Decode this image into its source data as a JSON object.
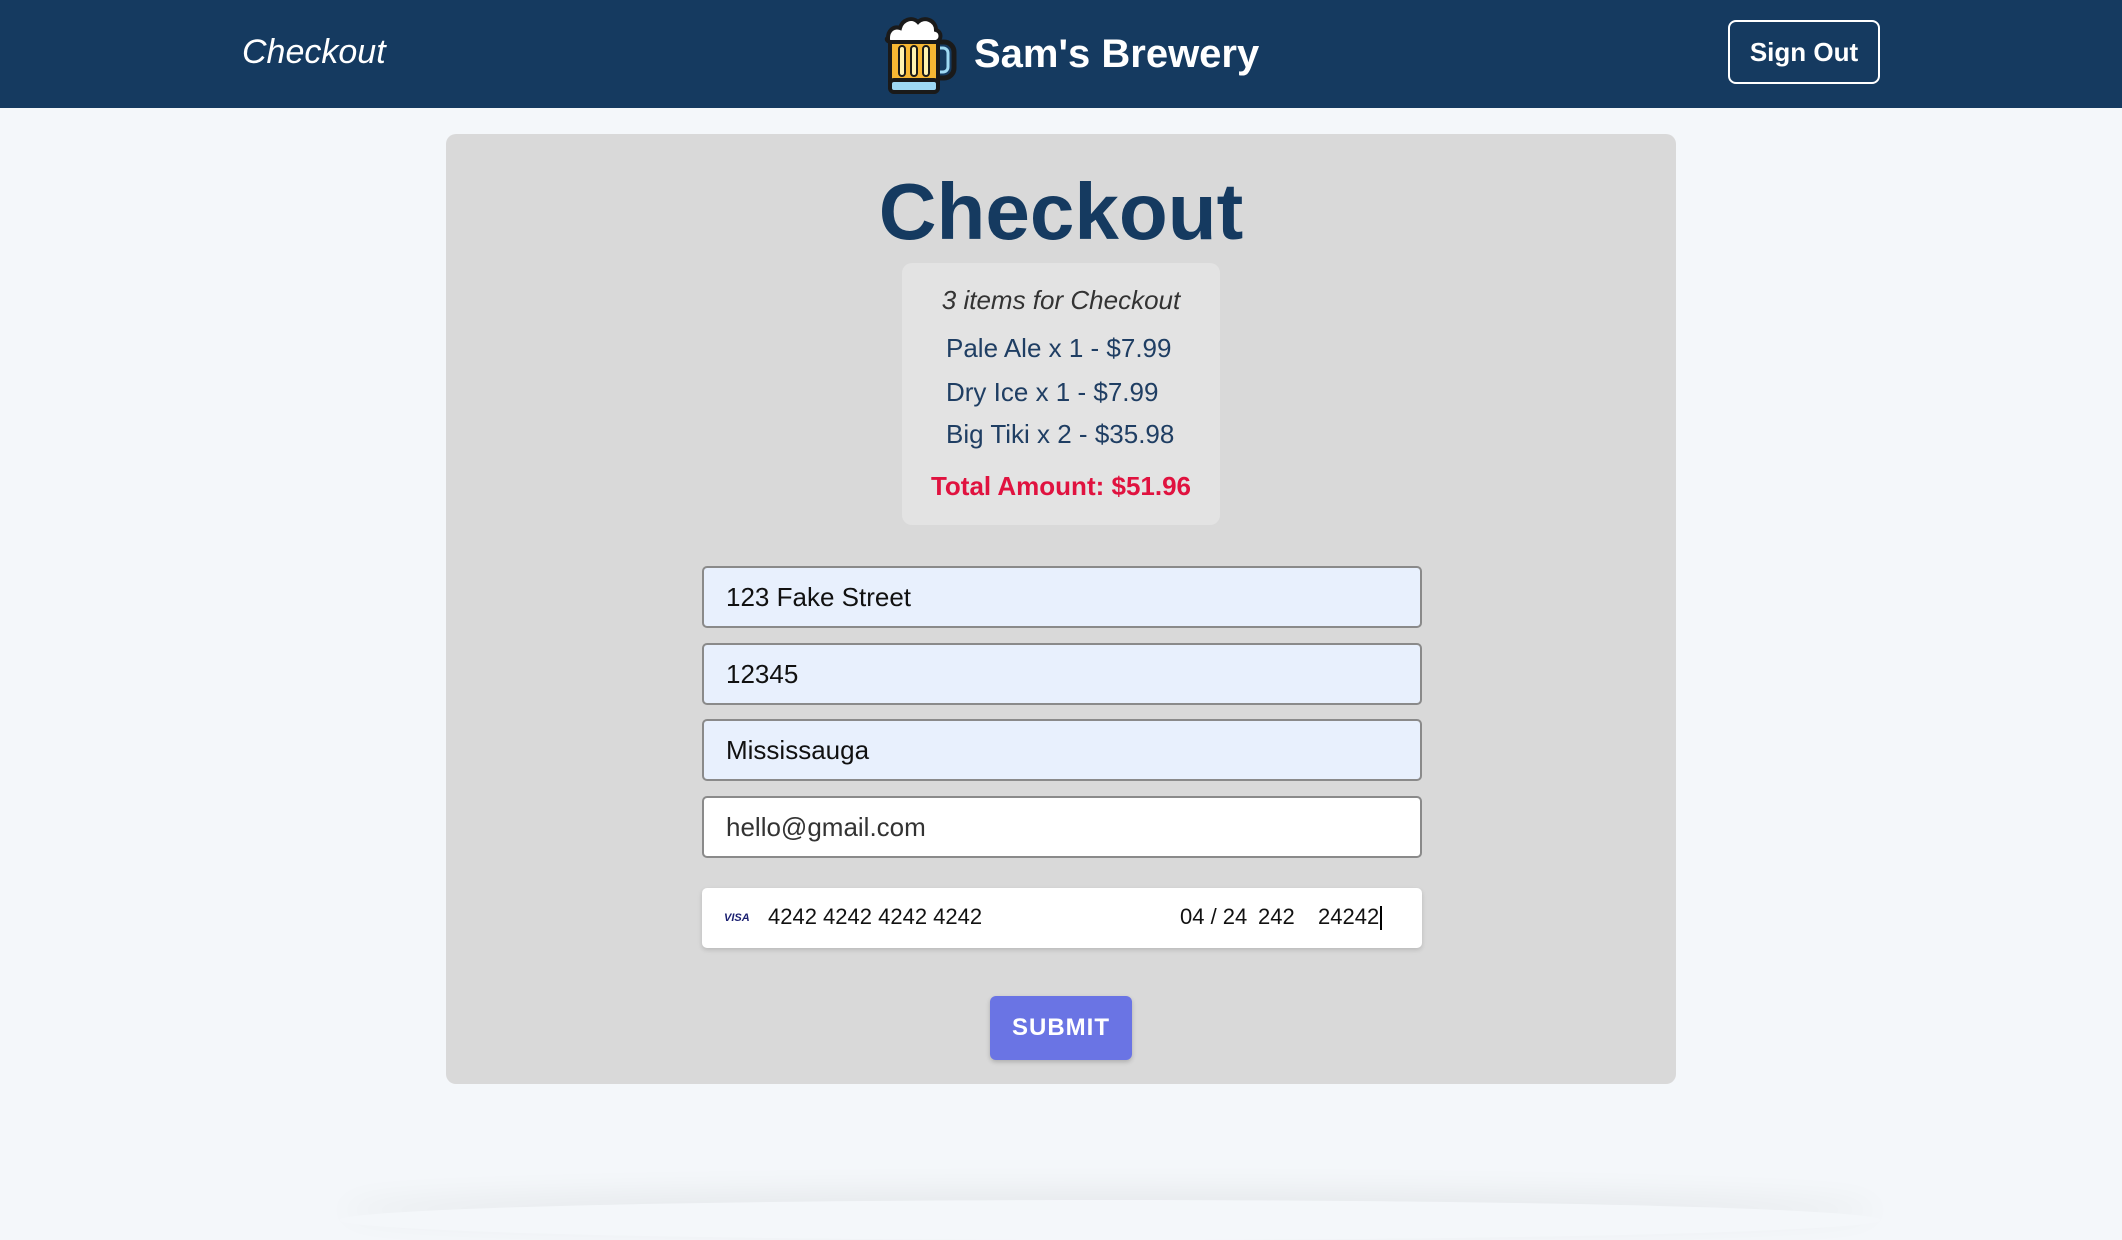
{
  "nav": {
    "page_label": "Checkout",
    "brand_name": "Sam's Brewery",
    "brand_icon": "beer-mug-icon",
    "sign_out_label": "Sign Out"
  },
  "checkout": {
    "title": "Checkout",
    "summary": {
      "count_text": "3 items for Checkout",
      "items": [
        {
          "text": "Pale Ale x 1 - $7.99"
        },
        {
          "text": "Dry Ice x 1 - $7.99"
        },
        {
          "text": "Big Tiki x 2 - $35.98"
        }
      ],
      "total_text": "Total Amount: $51.96"
    },
    "fields": {
      "address": "123 Fake Street",
      "postal": "12345",
      "city": "Mississauga",
      "email": "hello@gmail.com"
    },
    "card": {
      "brand": "VISA",
      "number": "4242 4242 4242 4242",
      "expiry": "04 / 24",
      "cvc": "242",
      "zip": "24242"
    },
    "submit_label": "SUBMIT"
  },
  "colors": {
    "navbar": "#153a60",
    "title": "#153a60",
    "total": "#e0123f",
    "submit": "#6a74e4"
  }
}
